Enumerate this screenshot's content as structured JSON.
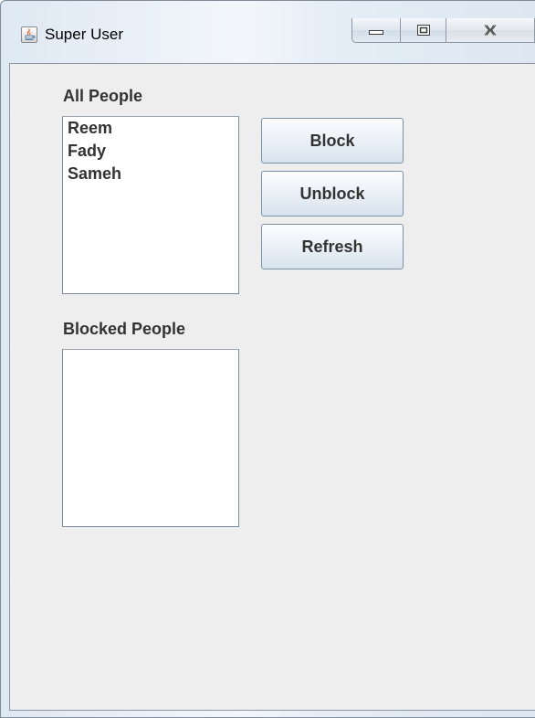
{
  "window": {
    "title": "Super User",
    "app_icon": "java-coffee-icon",
    "controls": {
      "minimize_icon": "minimize-icon",
      "maximize_icon": "maximize-icon",
      "close_icon": "close-icon"
    }
  },
  "all_people": {
    "label": "All People",
    "items": [
      "Reem",
      "Fady",
      "Sameh"
    ]
  },
  "blocked_people": {
    "label": "Blocked People",
    "items": []
  },
  "buttons": {
    "block": "Block",
    "unblock": "Unblock",
    "refresh": "Refresh"
  },
  "colors": {
    "client_background": "#eeeeee",
    "text": "#333333",
    "list_background": "#ffffff"
  }
}
